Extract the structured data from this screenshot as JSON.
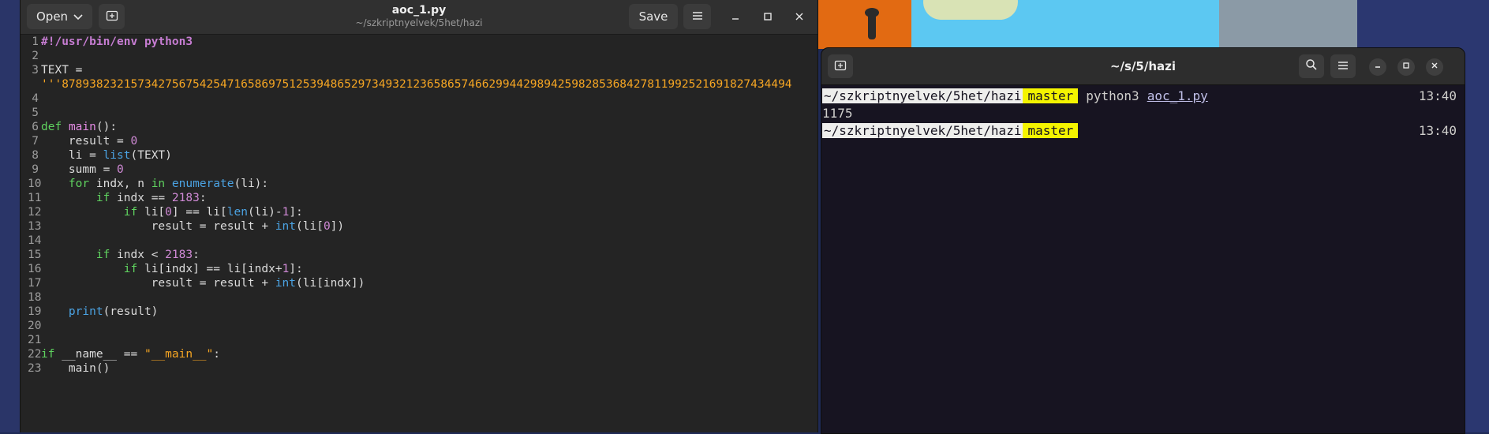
{
  "gedit": {
    "open_label": "Open",
    "save_label": "Save",
    "title": "aoc_1.py",
    "subtitle": "~/szkriptnyelvek/5het/hazi",
    "icons": {
      "new_tab": "new-tab-icon",
      "menu": "hamburger-menu-icon",
      "minimize": "minimize-icon",
      "maximize": "maximize-icon",
      "close": "close-icon"
    },
    "lines": [
      {
        "n": "1",
        "segments": [
          {
            "t": "#!/usr/bin/env python3",
            "c": "sh"
          }
        ]
      },
      {
        "n": "2",
        "segments": []
      },
      {
        "n": "3",
        "segments": [
          {
            "t": "TEXT =",
            "c": ""
          }
        ]
      },
      {
        "n": "",
        "segments": [
          {
            "t": "'''8789382321573427567542547165869751253948652973493212365865746629944298942598285368427811992521691827434494",
            "c": "str"
          }
        ]
      },
      {
        "n": "4",
        "segments": []
      },
      {
        "n": "5",
        "segments": []
      },
      {
        "n": "6",
        "segments": [
          {
            "t": "def",
            "c": "kw"
          },
          {
            "t": " ",
            "c": ""
          },
          {
            "t": "main",
            "c": "fn"
          },
          {
            "t": "():",
            "c": ""
          }
        ]
      },
      {
        "n": "7",
        "segments": [
          {
            "t": "    result = ",
            "c": ""
          },
          {
            "t": "0",
            "c": "num"
          }
        ]
      },
      {
        "n": "8",
        "segments": [
          {
            "t": "    li = ",
            "c": ""
          },
          {
            "t": "list",
            "c": "bi"
          },
          {
            "t": "(TEXT)",
            "c": ""
          }
        ]
      },
      {
        "n": "9",
        "segments": [
          {
            "t": "    summ = ",
            "c": ""
          },
          {
            "t": "0",
            "c": "num"
          }
        ]
      },
      {
        "n": "10",
        "segments": [
          {
            "t": "    ",
            "c": ""
          },
          {
            "t": "for",
            "c": "kw"
          },
          {
            "t": " indx, n ",
            "c": ""
          },
          {
            "t": "in",
            "c": "kw"
          },
          {
            "t": " ",
            "c": ""
          },
          {
            "t": "enumerate",
            "c": "bi"
          },
          {
            "t": "(li):",
            "c": ""
          }
        ]
      },
      {
        "n": "11",
        "segments": [
          {
            "t": "        ",
            "c": ""
          },
          {
            "t": "if",
            "c": "kw"
          },
          {
            "t": " indx == ",
            "c": ""
          },
          {
            "t": "2183",
            "c": "num"
          },
          {
            "t": ":",
            "c": ""
          }
        ]
      },
      {
        "n": "12",
        "segments": [
          {
            "t": "            ",
            "c": ""
          },
          {
            "t": "if",
            "c": "kw"
          },
          {
            "t": " li[",
            "c": ""
          },
          {
            "t": "0",
            "c": "num"
          },
          {
            "t": "] == li[",
            "c": ""
          },
          {
            "t": "len",
            "c": "bi"
          },
          {
            "t": "(li)-",
            "c": ""
          },
          {
            "t": "1",
            "c": "num"
          },
          {
            "t": "]:",
            "c": ""
          }
        ]
      },
      {
        "n": "13",
        "segments": [
          {
            "t": "                result = result + ",
            "c": ""
          },
          {
            "t": "int",
            "c": "bi"
          },
          {
            "t": "(li[",
            "c": ""
          },
          {
            "t": "0",
            "c": "num"
          },
          {
            "t": "])",
            "c": ""
          }
        ]
      },
      {
        "n": "14",
        "segments": []
      },
      {
        "n": "15",
        "segments": [
          {
            "t": "        ",
            "c": ""
          },
          {
            "t": "if",
            "c": "kw"
          },
          {
            "t": " indx < ",
            "c": ""
          },
          {
            "t": "2183",
            "c": "num"
          },
          {
            "t": ":",
            "c": ""
          }
        ]
      },
      {
        "n": "16",
        "segments": [
          {
            "t": "            ",
            "c": ""
          },
          {
            "t": "if",
            "c": "kw"
          },
          {
            "t": " li[indx] == li[indx+",
            "c": ""
          },
          {
            "t": "1",
            "c": "num"
          },
          {
            "t": "]:",
            "c": ""
          }
        ]
      },
      {
        "n": "17",
        "segments": [
          {
            "t": "                result = result + ",
            "c": ""
          },
          {
            "t": "int",
            "c": "bi"
          },
          {
            "t": "(li[indx])",
            "c": ""
          }
        ]
      },
      {
        "n": "18",
        "segments": []
      },
      {
        "n": "19",
        "segments": [
          {
            "t": "    ",
            "c": ""
          },
          {
            "t": "print",
            "c": "bi"
          },
          {
            "t": "(result)",
            "c": ""
          }
        ]
      },
      {
        "n": "20",
        "segments": []
      },
      {
        "n": "21",
        "segments": []
      },
      {
        "n": "22",
        "segments": [
          {
            "t": "if",
            "c": "kw"
          },
          {
            "t": " __name__ == ",
            "c": ""
          },
          {
            "t": "\"__main__\"",
            "c": "str"
          },
          {
            "t": ":",
            "c": ""
          }
        ]
      },
      {
        "n": "23",
        "segments": [
          {
            "t": "    main()",
            "c": ""
          }
        ]
      }
    ]
  },
  "terminal": {
    "title": "~/s/5/hazi",
    "icons": {
      "new_tab": "new-tab-icon",
      "search": "search-icon",
      "menu": "hamburger-menu-icon",
      "minimize": "minimize-icon",
      "maximize": "maximize-icon",
      "close": "close-icon"
    },
    "lines": [
      {
        "path": "~/szkriptnyelvek/5het/hazi",
        "branch": "master",
        "cmd": "python3",
        "arg": "aoc_1.py",
        "time": "13:40"
      },
      {
        "output": "1175"
      },
      {
        "path": "~/szkriptnyelvek/5het/hazi",
        "branch": "master",
        "cmd": "",
        "arg": "",
        "time": "13:40"
      }
    ]
  },
  "colors": {
    "keyword": "#5fd35f",
    "builtin": "#4ba3e3",
    "number": "#d08ad6",
    "string": "#f6a623",
    "branch_bg": "#f4f400"
  }
}
